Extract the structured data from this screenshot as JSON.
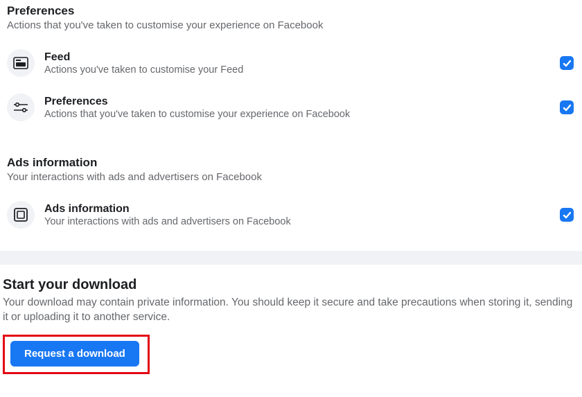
{
  "sections": [
    {
      "title": "Preferences",
      "subtitle": "Actions that you've taken to customise your experience on Facebook",
      "items": [
        {
          "title": "Feed",
          "subtitle": "Actions you've taken to customise your Feed"
        },
        {
          "title": "Preferences",
          "subtitle": "Actions that you've taken to customise your experience on Facebook"
        }
      ]
    },
    {
      "title": "Ads information",
      "subtitle": "Your interactions with ads and advertisers on Facebook",
      "items": [
        {
          "title": "Ads information",
          "subtitle": "Your interactions with ads and advertisers on Facebook"
        }
      ]
    }
  ],
  "download": {
    "title": "Start your download",
    "subtitle": "Your download may contain private information. You should keep it secure and take precautions when storing it, sending it or uploading it to another service.",
    "button": "Request a download"
  }
}
